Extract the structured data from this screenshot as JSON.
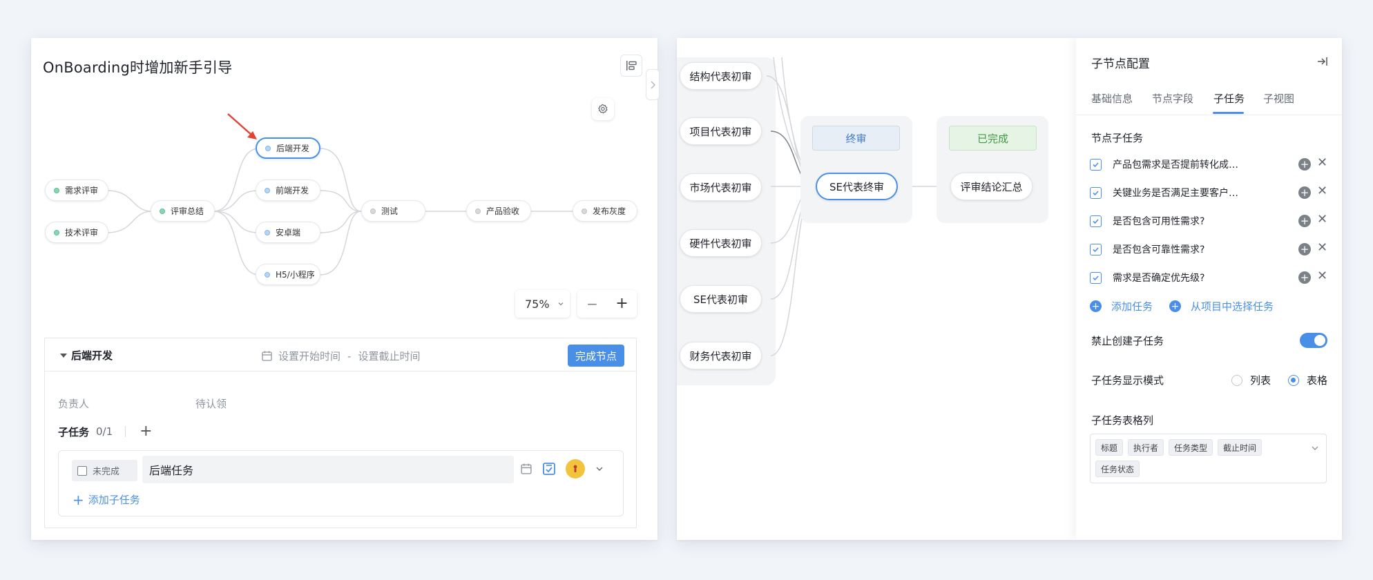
{
  "left": {
    "title": "OnBoarding时增加新手引导",
    "nodes": {
      "req_review": "需求评审",
      "tech_review": "技术评审",
      "review_summary": "评审总结",
      "backend": "后端开发",
      "frontend": "前端开发",
      "android": "安卓端",
      "h5": "H5/小程序",
      "test": "测试",
      "product_accept": "产品验收",
      "release": "发布灰度"
    },
    "zoom": "75%",
    "zoom_minus": "−",
    "zoom_plus": "+",
    "detail": {
      "node_title": "后端开发",
      "start_time": "设置开始时间",
      "date_sep": "-",
      "end_time": "设置截止时间",
      "complete_button": "完成节点",
      "owner_label": "负责人",
      "owner_value": "待认领",
      "subtasks_label": "子任务",
      "subtasks_count": "0/1",
      "add_icon": "+",
      "subtask": {
        "status": "未完成",
        "title": "后端任务"
      },
      "add_subtask": "添加子任务"
    },
    "colors": {
      "accent": "#4a8fe7",
      "arrow": "#e34234"
    }
  },
  "right": {
    "reviewers": [
      "结构代表初审",
      "项目代表初审",
      "市场代表初审",
      "硬件代表初审",
      "SE代表初审",
      "财务代表初审"
    ],
    "stage_final": {
      "label": "终审",
      "node": "SE代表终审"
    },
    "stage_done": {
      "label": "已完成",
      "node": "评审结论汇总"
    },
    "config": {
      "title": "子节点配置",
      "tabs": [
        "基础信息",
        "节点字段",
        "子任务",
        "子视图"
      ],
      "active_tab": "子任务",
      "section_tasks": "节点子任务",
      "tasks": [
        "产品包需求是否提前转化成了设计需求",
        "关键业务是否满足主要客户提出的需求",
        "是否包含可用性需求?",
        "是否包含可靠性需求?",
        "需求是否确定优先级?"
      ],
      "add_task": "添加任务",
      "select_from_project": "从项目中选择任务",
      "forbid_create_label": "禁止创建子任务",
      "forbid_create_on": true,
      "display_mode_label": "子任务显示模式",
      "mode_list": "列表",
      "mode_table": "表格",
      "mode_selected": "表格",
      "columns_label": "子任务表格列",
      "columns": [
        "标题",
        "执行者",
        "任务类型",
        "截止时间",
        "任务状态"
      ]
    }
  }
}
